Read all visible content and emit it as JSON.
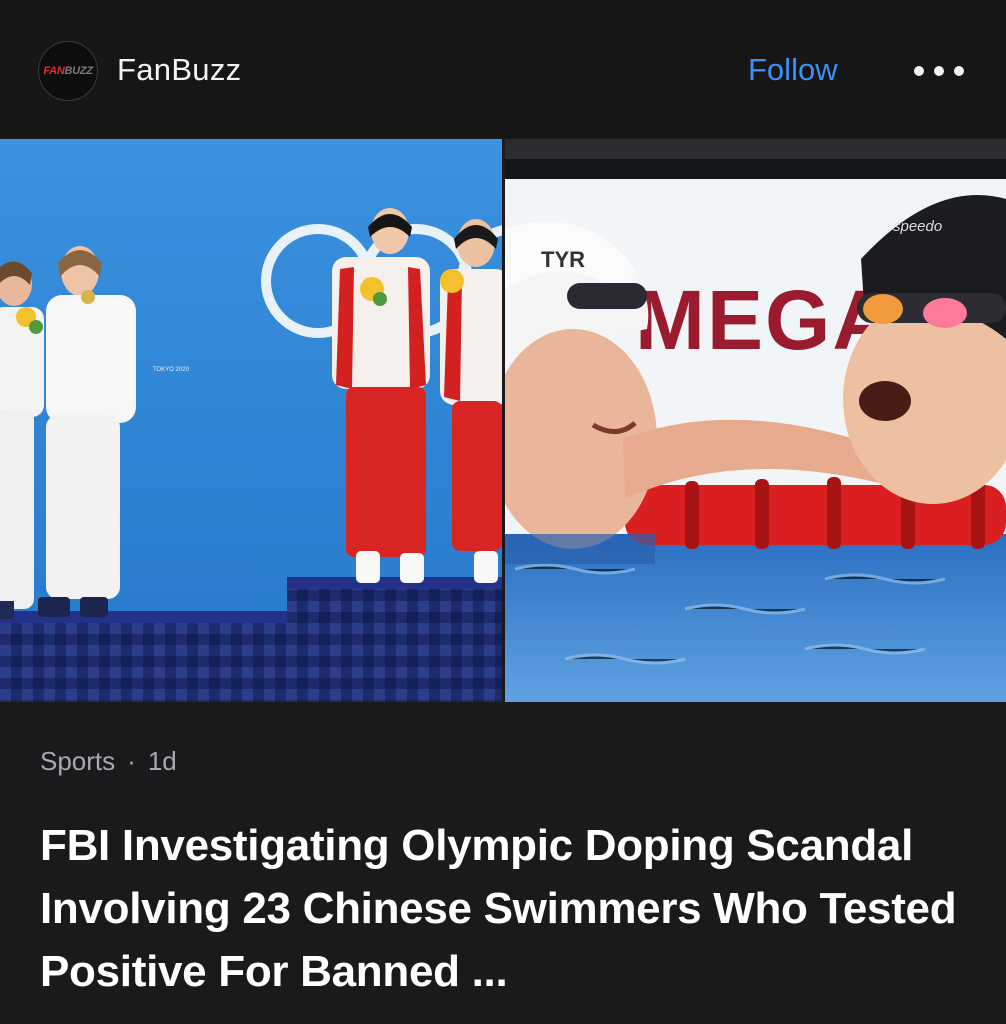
{
  "source": {
    "logo_fan": "FAN",
    "logo_buzz": "BUZZ",
    "name": "FanBuzz",
    "follow_label": "Follow",
    "more_icon": "more-horizontal-icon"
  },
  "hero": {
    "left_image_text": "TOKYO 2020",
    "right_image_banner": "MEGA",
    "right_cap_brand_left": "TYR",
    "right_cap_brand_right": "speedo"
  },
  "article": {
    "category": "Sports",
    "separator": "·",
    "age": "1d",
    "headline": "FBI Investigating Olympic Doping Scandal Involving 23 Chinese Swimmers Who Tested Positive For Banned ..."
  },
  "colors": {
    "accent": "#3d8ef5",
    "background": "#1a1a1c",
    "podium_blue": "#2f86d6",
    "lane_red": "#d91f1f"
  }
}
